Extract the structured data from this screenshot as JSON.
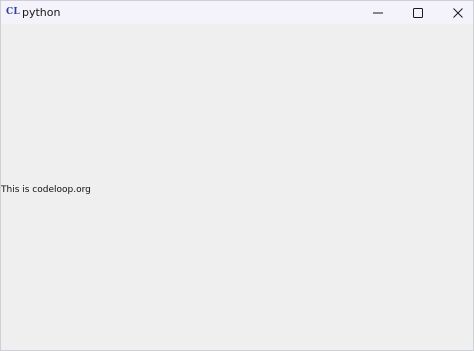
{
  "window": {
    "icon_text": "CL",
    "title": "python",
    "controls": {
      "minimize": "minimize-icon",
      "maximize": "maximize-icon",
      "close": "close-icon"
    }
  },
  "content": {
    "label_text": "This is codeloop.org"
  },
  "colors": {
    "titlebar": "#f4f2fb",
    "background": "#efefef",
    "icon": "#2b3f9e",
    "text": "#111111"
  }
}
